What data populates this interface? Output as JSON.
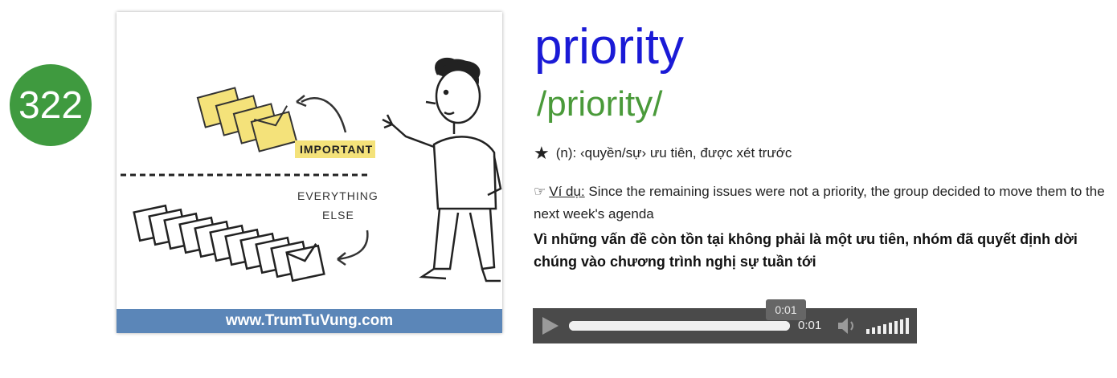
{
  "entry": {
    "number": "322",
    "word": "priority",
    "pronunciation": "/priority/",
    "meaning": "(n): ‹quyền/sự› ưu tiên, được xét trước",
    "example_label": "Ví dụ:",
    "example_text": "Since the remaining issues were not a priority, the group decided to move them to the next week's agenda",
    "translation": "Vì những vấn đề còn tồn tại không phải là một ưu tiên, nhóm đã quyết định dời chúng vào chương trình nghị sự tuần tới"
  },
  "illustration": {
    "label_important": "IMPORTANT",
    "label_everything": "EVERYTHING",
    "label_else": "ELSE",
    "footer": "www.TrumTuVung.com"
  },
  "player": {
    "tooltip_time": "0:01",
    "current_time": "0:01",
    "progress": 1.0,
    "volume": 1.0
  },
  "icons": {
    "meaning": "star-icon",
    "example": "pointing-hand-icon",
    "play": "play-icon",
    "volume": "speaker-icon"
  }
}
